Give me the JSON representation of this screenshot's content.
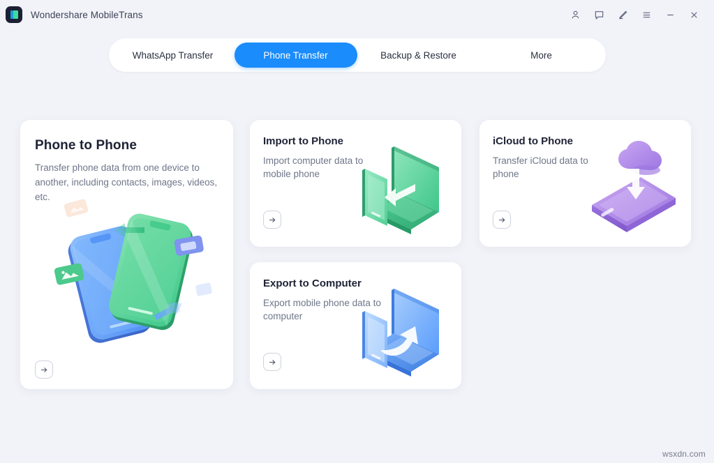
{
  "window": {
    "app_title": "Wondershare MobileTrans",
    "logo_icon": "mobiletrans-logo-icon",
    "controls": [
      {
        "name": "account-icon",
        "label": "Account"
      },
      {
        "name": "feedback-icon",
        "label": "Feedback"
      },
      {
        "name": "edit-icon",
        "label": "Edit"
      },
      {
        "name": "menu-icon",
        "label": "Menu"
      },
      {
        "name": "minimize-icon",
        "label": "Minimize"
      },
      {
        "name": "close-icon",
        "label": "Close"
      }
    ]
  },
  "tabs": [
    {
      "label": "WhatsApp Transfer",
      "active": false
    },
    {
      "label": "Phone Transfer",
      "active": true
    },
    {
      "label": "Backup & Restore",
      "active": false
    },
    {
      "label": "More",
      "active": false
    }
  ],
  "cards": {
    "phone_to_phone": {
      "title": "Phone to Phone",
      "desc": "Transfer phone data from one device to another, including contacts, images, videos, etc.",
      "action_icon": "arrow-right-icon"
    },
    "import_to_phone": {
      "title": "Import to Phone",
      "desc": "Import computer data to mobile phone",
      "action_icon": "arrow-right-icon"
    },
    "icloud_to_phone": {
      "title": "iCloud to Phone",
      "desc": "Transfer iCloud data to phone",
      "action_icon": "arrow-right-icon"
    },
    "export_to_computer": {
      "title": "Export to Computer",
      "desc": "Export mobile phone data to computer",
      "action_icon": "arrow-right-icon"
    }
  },
  "watermark": "wsxdn.com",
  "colors": {
    "accent": "#1a8cfb",
    "page_bg": "#f2f3f8",
    "card_bg": "#ffffff",
    "title_text": "#1e2235",
    "body_text": "#6f7689",
    "green_illus": "#46c98a",
    "blue_illus": "#5b9dfb",
    "purple_illus": "#a785e4"
  }
}
